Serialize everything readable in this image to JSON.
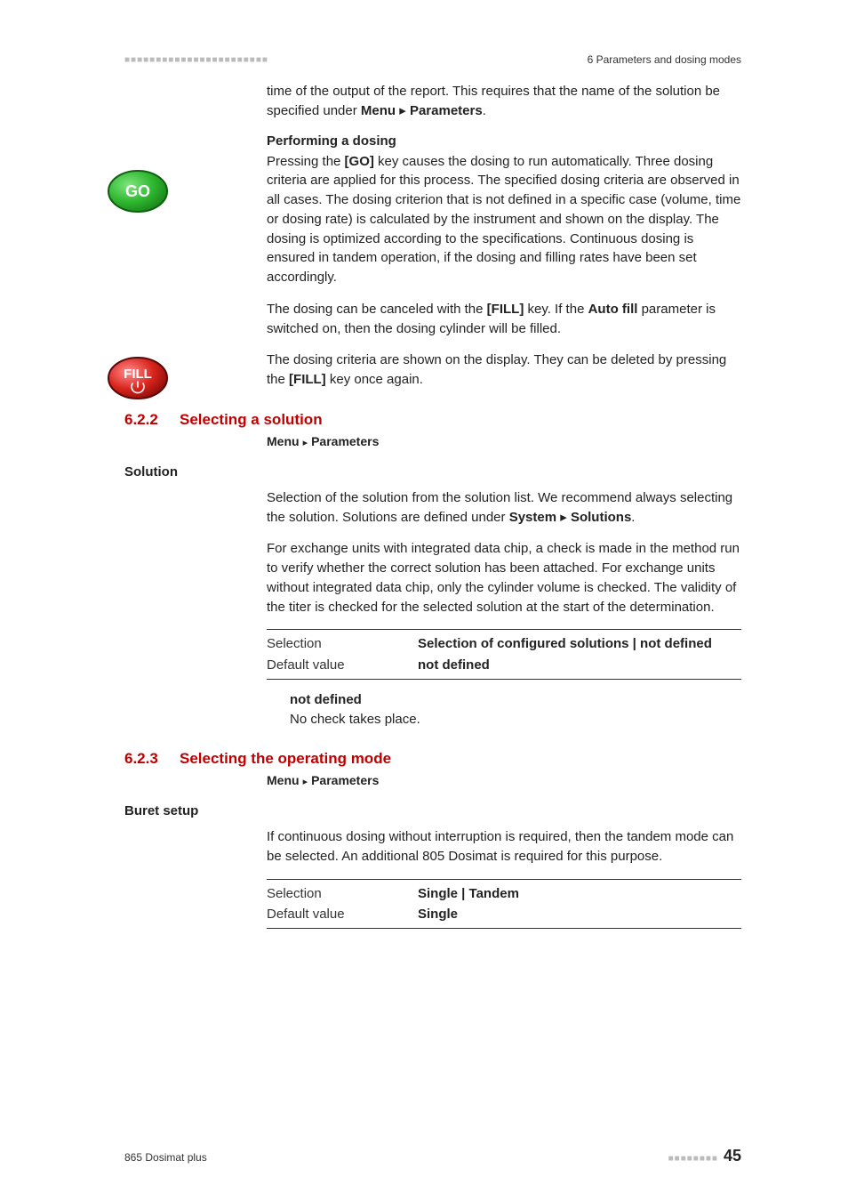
{
  "header": {
    "dots": "■■■■■■■■■■■■■■■■■■■■■■■",
    "right": "6 Parameters and dosing modes"
  },
  "intro": {
    "p1_a": "time of the output of the report. This requires that the name of the solution be specified under ",
    "p1_b_bold": "Menu",
    "p1_c": " ▸ ",
    "p1_d_bold": "Parameters",
    "p1_e": "."
  },
  "perform": {
    "heading": "Performing a dosing",
    "p1_a": "Pressing the ",
    "p1_b_bold": "[GO]",
    "p1_c": " key causes the dosing to run automatically. Three dosing criteria are applied for this process. The specified dosing criteria are observed in all cases. The dosing criterion that is not defined in a specific case (volume, time or dosing rate) is calculated by the instrument and shown on the display. The dosing is optimized according to the specifications. Continuous dosing is ensured in tandem operation, if the dosing and filling rates have been set accordingly.",
    "p2_a": "The dosing can be canceled with the ",
    "p2_b_bold": "[FILL]",
    "p2_c": " key. If the ",
    "p2_d_bold": "Auto fill",
    "p2_e": " parameter is switched on, then the dosing cylinder will be filled.",
    "p3_a": "The dosing criteria are shown on the display. They can be deleted by pressing the ",
    "p3_b_bold": "[FILL]",
    "p3_c": " key once again."
  },
  "icons": {
    "go_label": "GO",
    "fill_label": "FILL"
  },
  "sec622": {
    "num": "6.2.2",
    "title": "Selecting a solution",
    "crumb_a": "Menu",
    "crumb_b": "Parameters",
    "field": "Solution",
    "p1_a": "Selection of the solution from the solution list. We recommend always selecting the solution. Solutions are defined under ",
    "p1_b_bold": "System",
    "p1_c": " ▸ ",
    "p1_d_bold": "Solutions",
    "p1_e": ".",
    "p2": "For exchange units with integrated data chip, a check is made in the method run to verify whether the correct solution has been attached. For exchange units without integrated data chip, only the cylinder volume is checked. The validity of the titer is checked for the selected solution at the start of the determination.",
    "row1_label": "Selection",
    "row1_val": "Selection of configured solutions | not defined",
    "row2_label": "Default value",
    "row2_val": "not defined",
    "def_term": "not defined",
    "def_desc": "No check takes place."
  },
  "sec623": {
    "num": "6.2.3",
    "title": "Selecting the operating mode",
    "crumb_a": "Menu",
    "crumb_b": "Parameters",
    "field": "Buret setup",
    "p1": "If continuous dosing without interruption is required, then the tandem mode can be selected. An additional 805 Dosimat is required for this purpose.",
    "row1_label": "Selection",
    "row1_val": "Single | Tandem",
    "row2_label": "Default value",
    "row2_val": "Single"
  },
  "footer": {
    "left": "865 Dosimat plus",
    "dots": "■■■■■■■■",
    "page": "45"
  }
}
